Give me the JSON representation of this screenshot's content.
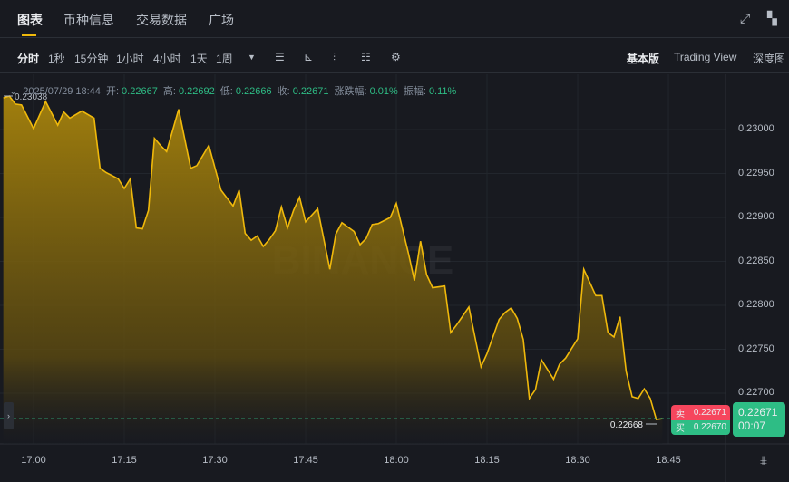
{
  "tabs": [
    {
      "label": "图表",
      "active": true
    },
    {
      "label": "币种信息"
    },
    {
      "label": "交易数据"
    },
    {
      "label": "广场"
    }
  ],
  "header_icons": [
    "expand-icon",
    "layout-grid-icon"
  ],
  "toolbar": {
    "intervals": [
      "分时",
      "1秒",
      "15分钟",
      "1小时",
      "4小时",
      "1天",
      "1周"
    ],
    "active_interval": "分时",
    "tool_icons": [
      "chevron-down-icon",
      "candle-style-icon",
      "indicator-icon",
      "chart-type-icon",
      "display-settings-icon",
      "gear-icon"
    ],
    "views": [
      "基本版",
      "Trading View",
      "深度图"
    ],
    "active_view": "基本版"
  },
  "info": {
    "datetime": "2025/07/29 18:44",
    "open_label": "开:",
    "open": "0.22667",
    "high_label": "高:",
    "high": "0.22692",
    "low_label": "低:",
    "low": "0.22666",
    "close_label": "收:",
    "close": "0.22671",
    "change_label": "涨跌幅:",
    "change": "0.01%",
    "amp_label": "振幅:",
    "amp": "0.11%"
  },
  "order": {
    "sell_label": "卖",
    "sell_price": "0.22671",
    "buy_label": "买",
    "buy_price": "0.22670"
  },
  "price_tag": {
    "price": "0.22671",
    "countdown": "00:07"
  },
  "watermark": "BINANCE",
  "colors": {
    "line": "#f0b90b",
    "up": "#2ebd85",
    "down": "#f6465d",
    "bg": "#181a20"
  },
  "chart_data": {
    "type": "area",
    "xticks": [
      "17:00",
      "17:15",
      "17:30",
      "17:45",
      "18:00",
      "18:15",
      "18:30",
      "18:45"
    ],
    "yticks": [
      "0.23000",
      "0.22950",
      "0.22900",
      "0.22850",
      "0.22800",
      "0.22750",
      "0.22700"
    ],
    "ylim": [
      0.2265,
      0.2305
    ],
    "high_marker": "0.23038",
    "low_marker": "0.22668",
    "last_price": 0.22671,
    "points": [
      [
        "16:55",
        0.23036
      ],
      [
        "16:56",
        0.23038
      ],
      [
        "16:57",
        0.23029
      ],
      [
        "16:58",
        0.23028
      ],
      [
        "17:00",
        0.23001
      ],
      [
        "17:02",
        0.23032
      ],
      [
        "17:04",
        0.23005
      ],
      [
        "17:05",
        0.2302
      ],
      [
        "17:06",
        0.23013
      ],
      [
        "17:08",
        0.23021
      ],
      [
        "17:10",
        0.23013
      ],
      [
        "17:11",
        0.22956
      ],
      [
        "17:12",
        0.22951
      ],
      [
        "17:14",
        0.22944
      ],
      [
        "17:15",
        0.22933
      ],
      [
        "17:16",
        0.22944
      ],
      [
        "17:17",
        0.22888
      ],
      [
        "17:18",
        0.22887
      ],
      [
        "17:19",
        0.22908
      ],
      [
        "17:20",
        0.2299
      ],
      [
        "17:21",
        0.22982
      ],
      [
        "17:22",
        0.22975
      ],
      [
        "17:24",
        0.23023
      ],
      [
        "17:26",
        0.22956
      ],
      [
        "17:27",
        0.22959
      ],
      [
        "17:29",
        0.22982
      ],
      [
        "17:31",
        0.22931
      ],
      [
        "17:33",
        0.22913
      ],
      [
        "17:34",
        0.22931
      ],
      [
        "17:35",
        0.22882
      ],
      [
        "17:36",
        0.22874
      ],
      [
        "17:37",
        0.22879
      ],
      [
        "17:38",
        0.22867
      ],
      [
        "17:39",
        0.22875
      ],
      [
        "17:40",
        0.22885
      ],
      [
        "17:41",
        0.22912
      ],
      [
        "17:42",
        0.22888
      ],
      [
        "17:43",
        0.22908
      ],
      [
        "17:44",
        0.22923
      ],
      [
        "17:45",
        0.22895
      ],
      [
        "17:47",
        0.2291
      ],
      [
        "17:49",
        0.22841
      ],
      [
        "17:50",
        0.22881
      ],
      [
        "17:51",
        0.22894
      ],
      [
        "17:53",
        0.22884
      ],
      [
        "17:54",
        0.22869
      ],
      [
        "17:55",
        0.22876
      ],
      [
        "17:56",
        0.22892
      ],
      [
        "17:57",
        0.22893
      ],
      [
        "17:59",
        0.229
      ],
      [
        "18:00",
        0.22916
      ],
      [
        "18:02",
        0.22859
      ],
      [
        "18:03",
        0.22828
      ],
      [
        "18:04",
        0.22873
      ],
      [
        "18:05",
        0.22835
      ],
      [
        "18:06",
        0.2282
      ],
      [
        "18:08",
        0.22822
      ],
      [
        "18:09",
        0.22769
      ],
      [
        "18:10",
        0.22778
      ],
      [
        "18:12",
        0.22798
      ],
      [
        "18:14",
        0.2273
      ],
      [
        "18:15",
        0.22745
      ],
      [
        "18:17",
        0.22784
      ],
      [
        "18:18",
        0.22792
      ],
      [
        "18:19",
        0.22797
      ],
      [
        "18:20",
        0.22785
      ],
      [
        "18:21",
        0.22761
      ],
      [
        "18:22",
        0.22694
      ],
      [
        "18:23",
        0.22704
      ],
      [
        "18:24",
        0.22738
      ],
      [
        "18:25",
        0.22727
      ],
      [
        "18:26",
        0.22716
      ],
      [
        "18:27",
        0.22733
      ],
      [
        "18:28",
        0.2274
      ],
      [
        "18:30",
        0.22762
      ],
      [
        "18:31",
        0.22841
      ],
      [
        "18:33",
        0.22811
      ],
      [
        "18:34",
        0.22811
      ],
      [
        "18:35",
        0.22769
      ],
      [
        "18:36",
        0.22764
      ],
      [
        "18:37",
        0.22787
      ],
      [
        "18:38",
        0.22725
      ],
      [
        "18:39",
        0.22696
      ],
      [
        "18:40",
        0.22694
      ],
      [
        "18:41",
        0.22705
      ],
      [
        "18:42",
        0.22694
      ],
      [
        "18:43",
        0.2267
      ],
      [
        "18:44",
        0.22671
      ]
    ]
  }
}
